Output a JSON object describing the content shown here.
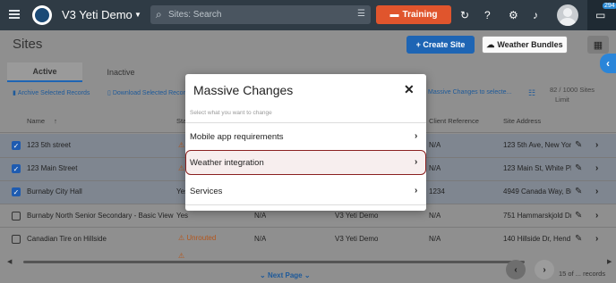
{
  "topbar": {
    "app_title": "V3 Yeti Demo",
    "search_placeholder": "Sites: Search",
    "training_label": "Training",
    "chat_badge": "294"
  },
  "page": {
    "title": "Sites",
    "create_label": "+ Create Site",
    "weather_label": "Weather Bundles"
  },
  "tabs": [
    "Active",
    "Inactive"
  ],
  "toolbar": {
    "archive_label": "Archive Selected Records",
    "download_label": "Download Selected Records",
    "massive_label": "Massive Changes to selecte...",
    "limit_line1": "82 / 1000 Sites",
    "limit_line2": "Limit"
  },
  "table": {
    "headers": [
      "Name",
      "Sta",
      "Client Reference",
      "Site Address"
    ],
    "rows": [
      {
        "name": "123 5th street",
        "status": "",
        "client": "",
        "ref": "N/A",
        "address": "123 5th Ave, New York",
        "selected": true
      },
      {
        "name": "123 Main Street",
        "status": "",
        "client": "",
        "ref": "N/A",
        "address": "123 Main St, White Pl",
        "selected": true
      },
      {
        "name": "Burnaby City Hall",
        "status": "Yes",
        "client": "",
        "ref": "1234",
        "address": "4949 Canada Way, Bu",
        "selected": true
      },
      {
        "name": "Burnaby North Senior Secondary - Basic View",
        "status": "Yes",
        "col3": "N/A",
        "client": "V3 Yeti Demo",
        "ref": "N/A",
        "address": "751 Hammarskjold Dr",
        "selected": false
      },
      {
        "name": "Canadian Tire on Hillside",
        "status": "Unrouted",
        "col3": "N/A",
        "client": "V3 Yeti Demo",
        "ref": "N/A",
        "address": "140 Hillside Dr, Hend",
        "selected": false
      }
    ]
  },
  "pagination": {
    "next_page": "Next Page",
    "records": "15 of ... records"
  },
  "modal": {
    "title": "Massive Changes",
    "subtitle": "Select what you want to change",
    "items": [
      "Mobile app requirements",
      "Weather integration",
      "Services"
    ]
  }
}
